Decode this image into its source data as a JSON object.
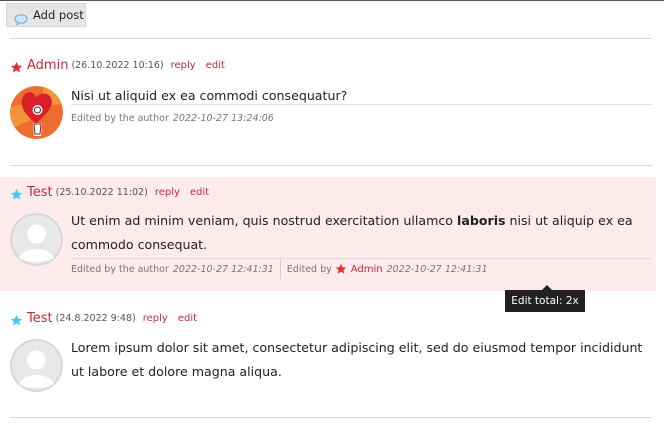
{
  "toolbar": {
    "add_post_label": "Add post",
    "icon": "speech-bubble-icon"
  },
  "colors": {
    "accent": "#c22a3a",
    "highlight_bg": "#fdebee",
    "admin_star": "#e62e3d",
    "user_star": "#45c9ea"
  },
  "posts": [
    {
      "author": "Admin",
      "role_icon": "red-star-icon",
      "date": "(26.10.2022 10:16)",
      "reply_label": "reply",
      "edit_label": "edit",
      "content_text": "Nisi ut aliquid ex ea commodi consequatur?",
      "edits": [
        {
          "by_text": "Edited by the author",
          "time": "2022-10-27 13:24:06"
        }
      ]
    },
    {
      "author": "Test",
      "role_icon": "blue-star-icon",
      "date": "(25.10.2022 11:02)",
      "reply_label": "reply",
      "edit_label": "edit",
      "content_before": "Ut enim ad minim veniam, quis nostrud exercitation ullamco ",
      "content_bold": "laboris",
      "content_after": " nisi ut aliquip ex ea commodo consequat.",
      "edits": [
        {
          "by_text": "Edited by the author",
          "time": "2022-10-27 12:41:31"
        },
        {
          "by_text": "Edited by",
          "author": "Admin",
          "time": "2022-10-27 12:41:31"
        }
      ]
    },
    {
      "author": "Test",
      "role_icon": "blue-star-icon",
      "date": "(24.8.2022 9:48)",
      "reply_label": "reply",
      "edit_label": "edit",
      "content_text": "Lorem ipsum dolor sit amet, consectetur adipiscing elit, sed do eiusmod tempor incididunt ut labore et dolore magna aliqua."
    }
  ],
  "tooltip": {
    "text": "Edit total: 2x"
  }
}
